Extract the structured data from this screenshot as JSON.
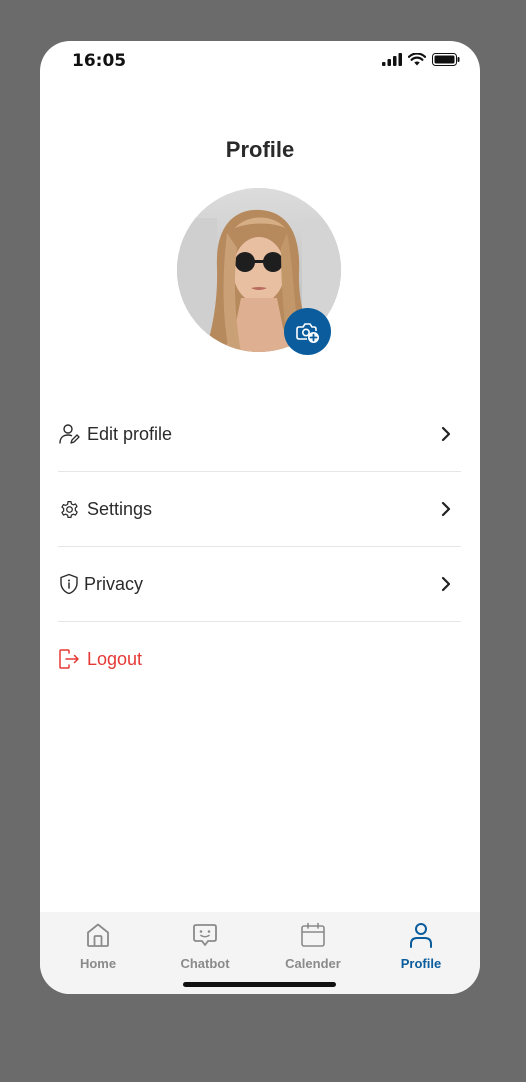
{
  "status_bar": {
    "time": "16:05",
    "icons": [
      "signal-icon",
      "wifi-icon",
      "battery-icon"
    ]
  },
  "header": {
    "title": "Profile"
  },
  "profile": {
    "avatar": "profile-photo",
    "camera_icon": "camera-add-icon"
  },
  "menu": {
    "items": [
      {
        "label": "Edit profile",
        "icon": "edit-user-icon",
        "color": "#2b2b2b"
      },
      {
        "label": "Settings",
        "icon": "gear-icon",
        "color": "#2b2b2b"
      },
      {
        "label": "Privacy",
        "icon": "shield-info-icon",
        "color": "#2b2b2b"
      },
      {
        "label": "Logout",
        "icon": "logout-icon",
        "color": "#e53935"
      }
    ]
  },
  "tabbar": {
    "tabs": [
      {
        "label": "Home",
        "icon": "home-icon",
        "active": false
      },
      {
        "label": "Chatbot",
        "icon": "chat-bot-icon",
        "active": false
      },
      {
        "label": "Calender",
        "icon": "calendar-icon",
        "active": false
      },
      {
        "label": "Profile",
        "icon": "user-icon",
        "active": true
      }
    ]
  },
  "colors": {
    "accent": "#0a5c9c",
    "logout": "#e53935",
    "background": "#6b6b6b",
    "tabbar": "#f4f4f4"
  }
}
